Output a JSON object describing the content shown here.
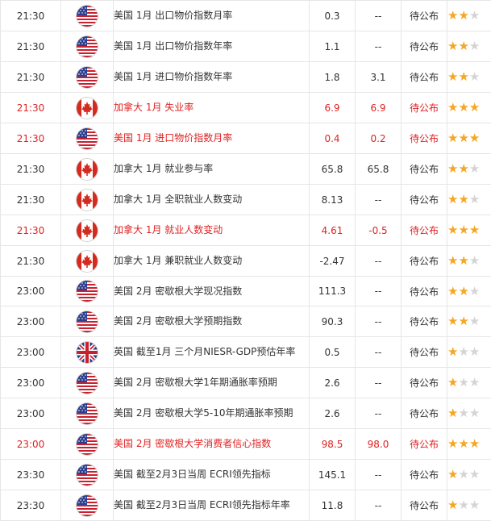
{
  "colors": {
    "important_text": "#e02222",
    "normal_text": "#333333",
    "star_filled": "#f5a623",
    "border": "#e6e6e6"
  },
  "rows": [
    {
      "time": "21:30",
      "country": "us",
      "flag_icon": "us-flag-icon",
      "event": "美国 1月 出口物价指数月率",
      "actual": "0.3",
      "forecast": "--",
      "previous": "待公布",
      "importance": 2,
      "important": false
    },
    {
      "time": "21:30",
      "country": "us",
      "flag_icon": "us-flag-icon",
      "event": "美国 1月 出口物价指数年率",
      "actual": "1.1",
      "forecast": "--",
      "previous": "待公布",
      "importance": 2,
      "important": false
    },
    {
      "time": "21:30",
      "country": "us",
      "flag_icon": "us-flag-icon",
      "event": "美国 1月 进口物价指数年率",
      "actual": "1.8",
      "forecast": "3.1",
      "previous": "待公布",
      "importance": 2,
      "important": false
    },
    {
      "time": "21:30",
      "country": "ca",
      "flag_icon": "canada-flag-icon",
      "event": "加拿大 1月 失业率",
      "actual": "6.9",
      "forecast": "6.9",
      "previous": "待公布",
      "importance": 3,
      "important": true
    },
    {
      "time": "21:30",
      "country": "us",
      "flag_icon": "us-flag-icon",
      "event": "美国 1月 进口物价指数月率",
      "actual": "0.4",
      "forecast": "0.2",
      "previous": "待公布",
      "importance": 3,
      "important": true
    },
    {
      "time": "21:30",
      "country": "ca",
      "flag_icon": "canada-flag-icon",
      "event": "加拿大 1月 就业参与率",
      "actual": "65.8",
      "forecast": "65.8",
      "previous": "待公布",
      "importance": 2,
      "important": false
    },
    {
      "time": "21:30",
      "country": "ca",
      "flag_icon": "canada-flag-icon",
      "event": "加拿大 1月 全职就业人数变动",
      "actual": "8.13",
      "forecast": "--",
      "previous": "待公布",
      "importance": 2,
      "important": false
    },
    {
      "time": "21:30",
      "country": "ca",
      "flag_icon": "canada-flag-icon",
      "event": "加拿大 1月 就业人数变动",
      "actual": "4.61",
      "forecast": "-0.5",
      "previous": "待公布",
      "importance": 3,
      "important": true
    },
    {
      "time": "21:30",
      "country": "ca",
      "flag_icon": "canada-flag-icon",
      "event": "加拿大 1月 兼职就业人数变动",
      "actual": "-2.47",
      "forecast": "--",
      "previous": "待公布",
      "importance": 2,
      "important": false
    },
    {
      "time": "23:00",
      "country": "us",
      "flag_icon": "us-flag-icon",
      "event": "美国 2月 密歇根大学现况指数",
      "actual": "111.3",
      "forecast": "--",
      "previous": "待公布",
      "importance": 2,
      "important": false
    },
    {
      "time": "23:00",
      "country": "us",
      "flag_icon": "us-flag-icon",
      "event": "美国 2月 密歇根大学预期指数",
      "actual": "90.3",
      "forecast": "--",
      "previous": "待公布",
      "importance": 2,
      "important": false
    },
    {
      "time": "23:00",
      "country": "uk",
      "flag_icon": "uk-flag-icon",
      "event": "英国 截至1月 三个月NIESR-GDP预估年率",
      "actual": "0.5",
      "forecast": "--",
      "previous": "待公布",
      "importance": 1,
      "important": false
    },
    {
      "time": "23:00",
      "country": "us",
      "flag_icon": "us-flag-icon",
      "event": "美国 2月 密歇根大学1年期通胀率预期",
      "actual": "2.6",
      "forecast": "--",
      "previous": "待公布",
      "importance": 1,
      "important": false
    },
    {
      "time": "23:00",
      "country": "us",
      "flag_icon": "us-flag-icon",
      "event": "美国 2月 密歇根大学5-10年期通胀率预期",
      "actual": "2.6",
      "forecast": "--",
      "previous": "待公布",
      "importance": 1,
      "important": false
    },
    {
      "time": "23:00",
      "country": "us",
      "flag_icon": "us-flag-icon",
      "event": "美国 2月 密歇根大学消费者信心指数",
      "actual": "98.5",
      "forecast": "98.0",
      "previous": "待公布",
      "importance": 3,
      "important": true
    },
    {
      "time": "23:30",
      "country": "us",
      "flag_icon": "us-flag-icon",
      "event": "美国 截至2月3日当周 ECRI领先指标",
      "actual": "145.1",
      "forecast": "--",
      "previous": "待公布",
      "importance": 1,
      "important": false
    },
    {
      "time": "23:30",
      "country": "us",
      "flag_icon": "us-flag-icon",
      "event": "美国 截至2月3日当周 ECRI领先指标年率",
      "actual": "11.8",
      "forecast": "--",
      "previous": "待公布",
      "importance": 1,
      "important": false
    }
  ]
}
